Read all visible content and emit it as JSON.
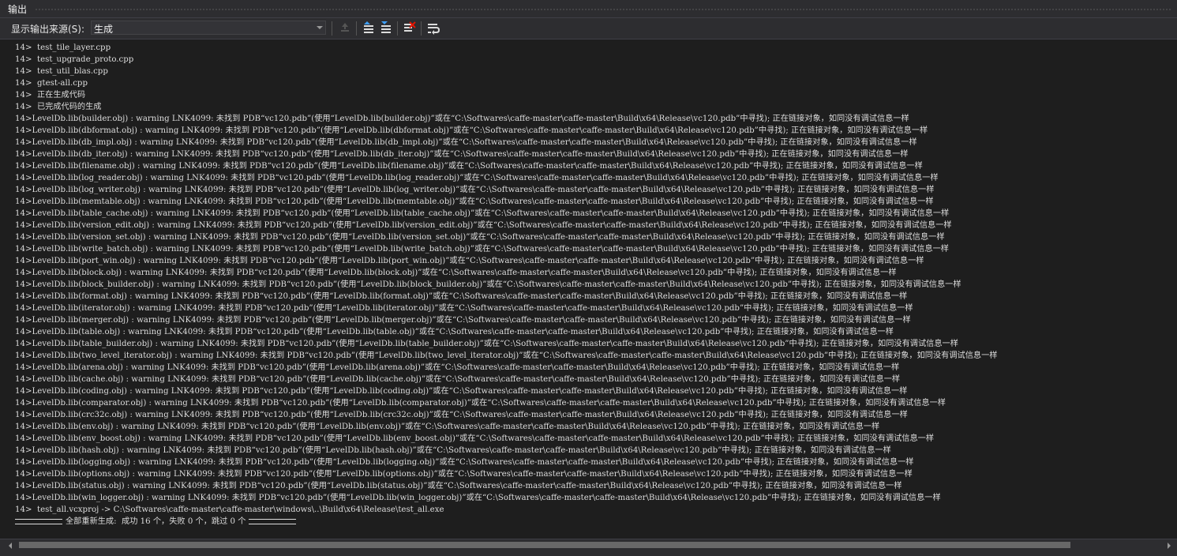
{
  "window": {
    "title": "输出"
  },
  "toolbar": {
    "source_label": "显示输出来源(S):",
    "source_value": "生成"
  },
  "output_lines": [
    "14>  test_tile_layer.cpp",
    "14>  test_upgrade_proto.cpp",
    "14>  test_util_blas.cpp",
    "14>  gtest-all.cpp",
    "14>  正在生成代码",
    "14>  已完成代码的生成",
    "14>LevelDb.lib(builder.obj) : warning LNK4099: 未找到 PDB“vc120.pdb”(使用“LevelDb.lib(builder.obj)”或在“C:\\Softwares\\caffe-master\\caffe-master\\Build\\x64\\Release\\vc120.pdb”中寻找); 正在链接对象，如同没有调试信息一样",
    "14>LevelDb.lib(dbformat.obj) : warning LNK4099: 未找到 PDB“vc120.pdb”(使用“LevelDb.lib(dbformat.obj)”或在“C:\\Softwares\\caffe-master\\caffe-master\\Build\\x64\\Release\\vc120.pdb”中寻找); 正在链接对象，如同没有调试信息一样",
    "14>LevelDb.lib(db_impl.obj) : warning LNK4099: 未找到 PDB“vc120.pdb”(使用“LevelDb.lib(db_impl.obj)”或在“C:\\Softwares\\caffe-master\\caffe-master\\Build\\x64\\Release\\vc120.pdb”中寻找); 正在链接对象，如同没有调试信息一样",
    "14>LevelDb.lib(db_iter.obj) : warning LNK4099: 未找到 PDB“vc120.pdb”(使用“LevelDb.lib(db_iter.obj)”或在“C:\\Softwares\\caffe-master\\caffe-master\\Build\\x64\\Release\\vc120.pdb”中寻找); 正在链接对象，如同没有调试信息一样",
    "14>LevelDb.lib(filename.obj) : warning LNK4099: 未找到 PDB“vc120.pdb”(使用“LevelDb.lib(filename.obj)”或在“C:\\Softwares\\caffe-master\\caffe-master\\Build\\x64\\Release\\vc120.pdb”中寻找); 正在链接对象，如同没有调试信息一样",
    "14>LevelDb.lib(log_reader.obj) : warning LNK4099: 未找到 PDB“vc120.pdb”(使用“LevelDb.lib(log_reader.obj)”或在“C:\\Softwares\\caffe-master\\caffe-master\\Build\\x64\\Release\\vc120.pdb”中寻找); 正在链接对象，如同没有调试信息一样",
    "14>LevelDb.lib(log_writer.obj) : warning LNK4099: 未找到 PDB“vc120.pdb”(使用“LevelDb.lib(log_writer.obj)”或在“C:\\Softwares\\caffe-master\\caffe-master\\Build\\x64\\Release\\vc120.pdb”中寻找); 正在链接对象，如同没有调试信息一样",
    "14>LevelDb.lib(memtable.obj) : warning LNK4099: 未找到 PDB“vc120.pdb”(使用“LevelDb.lib(memtable.obj)”或在“C:\\Softwares\\caffe-master\\caffe-master\\Build\\x64\\Release\\vc120.pdb”中寻找); 正在链接对象，如同没有调试信息一样",
    "14>LevelDb.lib(table_cache.obj) : warning LNK4099: 未找到 PDB“vc120.pdb”(使用“LevelDb.lib(table_cache.obj)”或在“C:\\Softwares\\caffe-master\\caffe-master\\Build\\x64\\Release\\vc120.pdb”中寻找); 正在链接对象，如同没有调试信息一样",
    "14>LevelDb.lib(version_edit.obj) : warning LNK4099: 未找到 PDB“vc120.pdb”(使用“LevelDb.lib(version_edit.obj)”或在“C:\\Softwares\\caffe-master\\caffe-master\\Build\\x64\\Release\\vc120.pdb”中寻找); 正在链接对象，如同没有调试信息一样",
    "14>LevelDb.lib(version_set.obj) : warning LNK4099: 未找到 PDB“vc120.pdb”(使用“LevelDb.lib(version_set.obj)”或在“C:\\Softwares\\caffe-master\\caffe-master\\Build\\x64\\Release\\vc120.pdb”中寻找); 正在链接对象，如同没有调试信息一样",
    "14>LevelDb.lib(write_batch.obj) : warning LNK4099: 未找到 PDB“vc120.pdb”(使用“LevelDb.lib(write_batch.obj)”或在“C:\\Softwares\\caffe-master\\caffe-master\\Build\\x64\\Release\\vc120.pdb”中寻找); 正在链接对象，如同没有调试信息一样",
    "14>LevelDb.lib(port_win.obj) : warning LNK4099: 未找到 PDB“vc120.pdb”(使用“LevelDb.lib(port_win.obj)”或在“C:\\Softwares\\caffe-master\\caffe-master\\Build\\x64\\Release\\vc120.pdb”中寻找); 正在链接对象，如同没有调试信息一样",
    "14>LevelDb.lib(block.obj) : warning LNK4099: 未找到 PDB“vc120.pdb”(使用“LevelDb.lib(block.obj)”或在“C:\\Softwares\\caffe-master\\caffe-master\\Build\\x64\\Release\\vc120.pdb”中寻找); 正在链接对象，如同没有调试信息一样",
    "14>LevelDb.lib(block_builder.obj) : warning LNK4099: 未找到 PDB“vc120.pdb”(使用“LevelDb.lib(block_builder.obj)”或在“C:\\Softwares\\caffe-master\\caffe-master\\Build\\x64\\Release\\vc120.pdb”中寻找); 正在链接对象，如同没有调试信息一样",
    "14>LevelDb.lib(format.obj) : warning LNK4099: 未找到 PDB“vc120.pdb”(使用“LevelDb.lib(format.obj)”或在“C:\\Softwares\\caffe-master\\caffe-master\\Build\\x64\\Release\\vc120.pdb”中寻找); 正在链接对象，如同没有调试信息一样",
    "14>LevelDb.lib(iterator.obj) : warning LNK4099: 未找到 PDB“vc120.pdb”(使用“LevelDb.lib(iterator.obj)”或在“C:\\Softwares\\caffe-master\\caffe-master\\Build\\x64\\Release\\vc120.pdb”中寻找); 正在链接对象，如同没有调试信息一样",
    "14>LevelDb.lib(merger.obj) : warning LNK4099: 未找到 PDB“vc120.pdb”(使用“LevelDb.lib(merger.obj)”或在“C:\\Softwares\\caffe-master\\caffe-master\\Build\\x64\\Release\\vc120.pdb”中寻找); 正在链接对象，如同没有调试信息一样",
    "14>LevelDb.lib(table.obj) : warning LNK4099: 未找到 PDB“vc120.pdb”(使用“LevelDb.lib(table.obj)”或在“C:\\Softwares\\caffe-master\\caffe-master\\Build\\x64\\Release\\vc120.pdb”中寻找); 正在链接对象，如同没有调试信息一样",
    "14>LevelDb.lib(table_builder.obj) : warning LNK4099: 未找到 PDB“vc120.pdb”(使用“LevelDb.lib(table_builder.obj)”或在“C:\\Softwares\\caffe-master\\caffe-master\\Build\\x64\\Release\\vc120.pdb”中寻找); 正在链接对象，如同没有调试信息一样",
    "14>LevelDb.lib(two_level_iterator.obj) : warning LNK4099: 未找到 PDB“vc120.pdb”(使用“LevelDb.lib(two_level_iterator.obj)”或在“C:\\Softwares\\caffe-master\\caffe-master\\Build\\x64\\Release\\vc120.pdb”中寻找); 正在链接对象，如同没有调试信息一样",
    "14>LevelDb.lib(arena.obj) : warning LNK4099: 未找到 PDB“vc120.pdb”(使用“LevelDb.lib(arena.obj)”或在“C:\\Softwares\\caffe-master\\caffe-master\\Build\\x64\\Release\\vc120.pdb”中寻找); 正在链接对象，如同没有调试信息一样",
    "14>LevelDb.lib(cache.obj) : warning LNK4099: 未找到 PDB“vc120.pdb”(使用“LevelDb.lib(cache.obj)”或在“C:\\Softwares\\caffe-master\\caffe-master\\Build\\x64\\Release\\vc120.pdb”中寻找); 正在链接对象，如同没有调试信息一样",
    "14>LevelDb.lib(coding.obj) : warning LNK4099: 未找到 PDB“vc120.pdb”(使用“LevelDb.lib(coding.obj)”或在“C:\\Softwares\\caffe-master\\caffe-master\\Build\\x64\\Release\\vc120.pdb”中寻找); 正在链接对象，如同没有调试信息一样",
    "14>LevelDb.lib(comparator.obj) : warning LNK4099: 未找到 PDB“vc120.pdb”(使用“LevelDb.lib(comparator.obj)”或在“C:\\Softwares\\caffe-master\\caffe-master\\Build\\x64\\Release\\vc120.pdb”中寻找); 正在链接对象，如同没有调试信息一样",
    "14>LevelDb.lib(crc32c.obj) : warning LNK4099: 未找到 PDB“vc120.pdb”(使用“LevelDb.lib(crc32c.obj)”或在“C:\\Softwares\\caffe-master\\caffe-master\\Build\\x64\\Release\\vc120.pdb”中寻找); 正在链接对象，如同没有调试信息一样",
    "14>LevelDb.lib(env.obj) : warning LNK4099: 未找到 PDB“vc120.pdb”(使用“LevelDb.lib(env.obj)”或在“C:\\Softwares\\caffe-master\\caffe-master\\Build\\x64\\Release\\vc120.pdb”中寻找); 正在链接对象，如同没有调试信息一样",
    "14>LevelDb.lib(env_boost.obj) : warning LNK4099: 未找到 PDB“vc120.pdb”(使用“LevelDb.lib(env_boost.obj)”或在“C:\\Softwares\\caffe-master\\caffe-master\\Build\\x64\\Release\\vc120.pdb”中寻找); 正在链接对象，如同没有调试信息一样",
    "14>LevelDb.lib(hash.obj) : warning LNK4099: 未找到 PDB“vc120.pdb”(使用“LevelDb.lib(hash.obj)”或在“C:\\Softwares\\caffe-master\\caffe-master\\Build\\x64\\Release\\vc120.pdb”中寻找); 正在链接对象，如同没有调试信息一样",
    "14>LevelDb.lib(logging.obj) : warning LNK4099: 未找到 PDB“vc120.pdb”(使用“LevelDb.lib(logging.obj)”或在“C:\\Softwares\\caffe-master\\caffe-master\\Build\\x64\\Release\\vc120.pdb”中寻找); 正在链接对象，如同没有调试信息一样",
    "14>LevelDb.lib(options.obj) : warning LNK4099: 未找到 PDB“vc120.pdb”(使用“LevelDb.lib(options.obj)”或在“C:\\Softwares\\caffe-master\\caffe-master\\Build\\x64\\Release\\vc120.pdb”中寻找); 正在链接对象，如同没有调试信息一样",
    "14>LevelDb.lib(status.obj) : warning LNK4099: 未找到 PDB“vc120.pdb”(使用“LevelDb.lib(status.obj)”或在“C:\\Softwares\\caffe-master\\caffe-master\\Build\\x64\\Release\\vc120.pdb”中寻找); 正在链接对象，如同没有调试信息一样",
    "14>LevelDb.lib(win_logger.obj) : warning LNK4099: 未找到 PDB“vc120.pdb”(使用“LevelDb.lib(win_logger.obj)”或在“C:\\Softwares\\caffe-master\\caffe-master\\Build\\x64\\Release\\vc120.pdb”中寻找); 正在链接对象，如同没有调试信息一样",
    "14>  test_all.vcxproj -> C:\\Softwares\\caffe-master\\caffe-master\\windows\\..\\Build\\x64\\Release\\test_all.exe"
  ],
  "summary": {
    "text": "全部重新生成:  成功 16 个，失败 0 个，跳过 0 个"
  },
  "icons": {
    "toolbar": [
      "go-to-previous-message-icon",
      "find-previous-icon",
      "find-next-icon",
      "clear-all-icon",
      "toggle-word-wrap-icon"
    ]
  },
  "colors": {
    "background": "#1e1e1e",
    "text": "#dcdcdc",
    "panel": "#2d2d30"
  }
}
